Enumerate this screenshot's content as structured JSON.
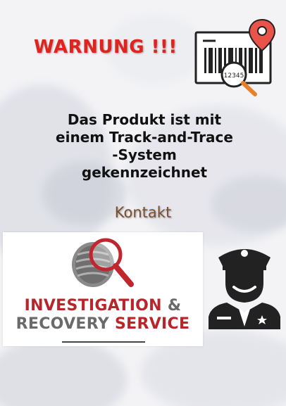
{
  "warning": {
    "title": "WARNUNG !!!"
  },
  "icons": {
    "barcode": "barcode-location-magnifier-icon",
    "barcode_number": "12345",
    "tire": "tire-magnifier-icon",
    "police": "police-officer-icon"
  },
  "message": {
    "lines": [
      "Das Produkt ist mit",
      "einem Track-and-Trace",
      "-System",
      "gekennzeichnet"
    ]
  },
  "contact": {
    "label": "Kontakt"
  },
  "logo": {
    "line1_red": "INVESTIGATION",
    "line1_grey": "&",
    "line2_grey": "RECOVERY",
    "line2_red": "SERVICE"
  },
  "colors": {
    "warning_red": "#e0231e",
    "brand_red": "#b8262b",
    "brand_grey": "#6a6a6a",
    "contact_brown": "#7a5030"
  }
}
